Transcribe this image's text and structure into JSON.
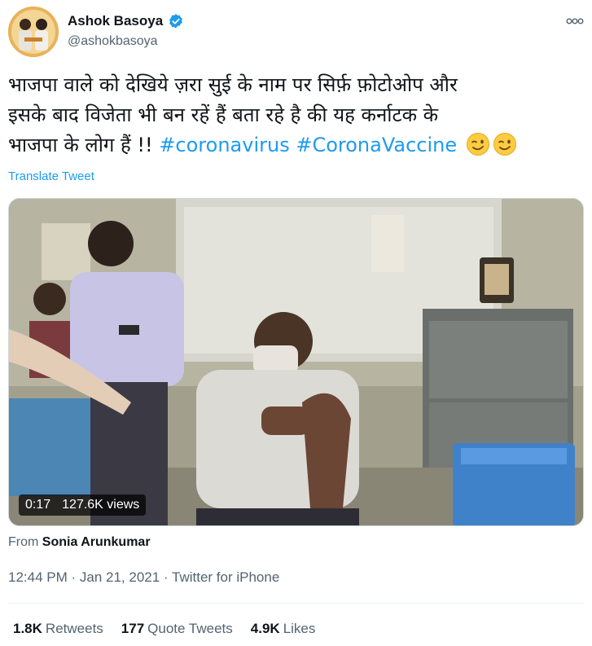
{
  "author": {
    "display_name": "Ashok Basoya",
    "handle": "@ashokbasoya",
    "verified": true,
    "verified_color": "#1d9bf0"
  },
  "tweet": {
    "text_line_1": "भाजपा वाले को देखिये ज़रा सुई के नाम पर सिर्फ़ फ़ोटोओप और",
    "text_line_2": "इसके बाद विजेता भी बन रहें हैं बता रहे है की यह कर्नाटक के",
    "text_line_3": "भाजपा के लोग हैं !! ",
    "hashtags": [
      "#coronavirus",
      "#CoronaVaccine"
    ],
    "emojis": [
      "winking-face",
      "winking-face"
    ],
    "translate_label": "Translate Tweet"
  },
  "media": {
    "duration": "0:17",
    "views": "127.6K views"
  },
  "source": {
    "from_label": "From",
    "from_name": "Sonia Arunkumar"
  },
  "meta": {
    "time": "12:44 PM",
    "date": "Jan 21, 2021",
    "separator": " · ",
    "client": "Twitter for iPhone"
  },
  "stats": {
    "retweets_count": "1.8K",
    "retweets_label": "Retweets",
    "quotes_count": "177",
    "quotes_label": "Quote Tweets",
    "likes_count": "4.9K",
    "likes_label": "Likes"
  },
  "colors": {
    "accent": "#1d9bf0",
    "text": "#0f1419",
    "secondary": "#536471"
  }
}
